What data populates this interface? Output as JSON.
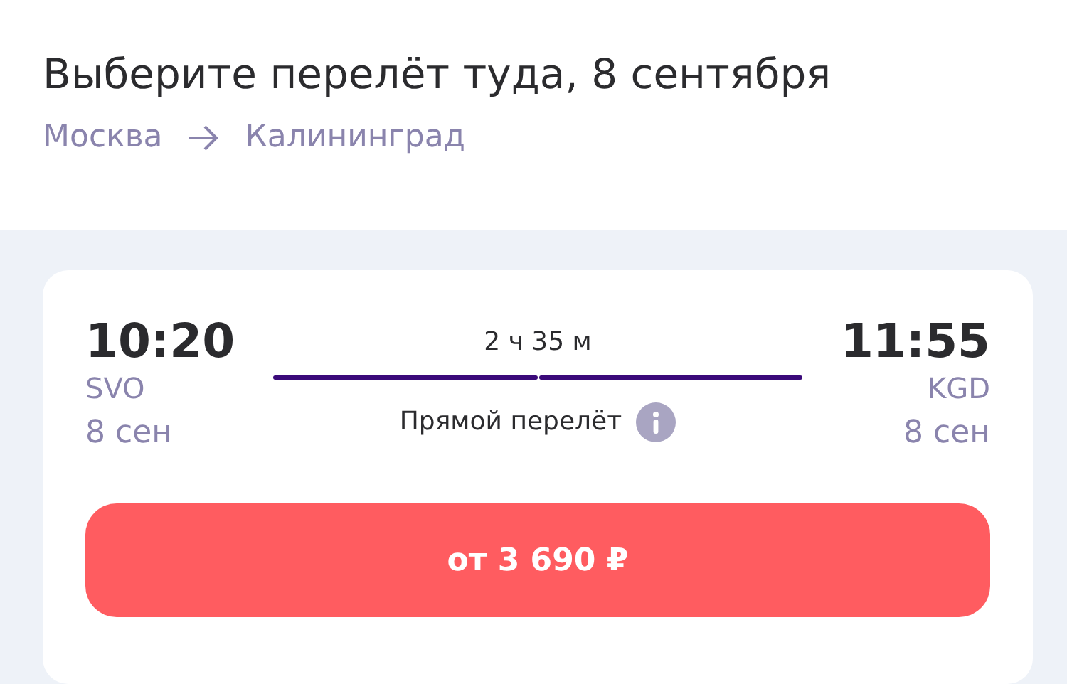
{
  "header": {
    "title": "Выберите перелёт туда, 8 сентября",
    "route": {
      "from": "Москва",
      "to": "Калининград"
    }
  },
  "flight": {
    "departure": {
      "time": "10:20",
      "airport": "SVO",
      "date": "8 сен"
    },
    "arrival": {
      "time": "11:55",
      "airport": "KGD",
      "date": "8 сен"
    },
    "duration": "2 ч 35 м",
    "stops": "Прямой перелёт",
    "price_button": "от 3 690 ₽"
  }
}
